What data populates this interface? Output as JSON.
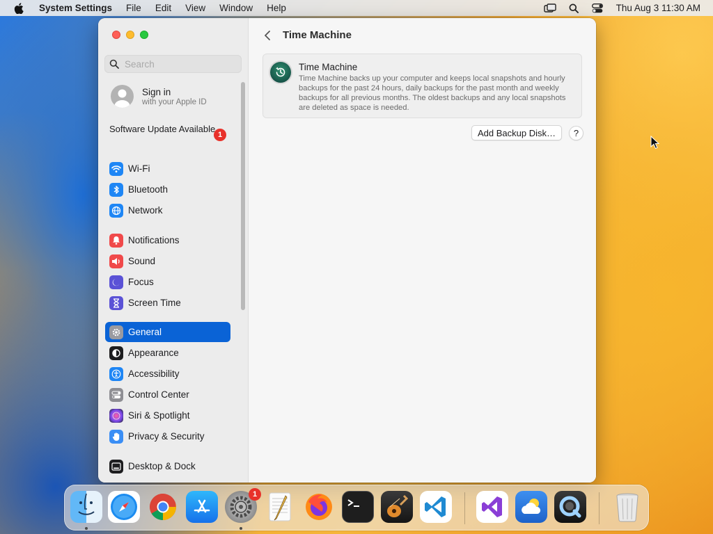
{
  "menubar": {
    "app_name": "System Settings",
    "menus": [
      "File",
      "Edit",
      "View",
      "Window",
      "Help"
    ],
    "clock": "Thu Aug 3  11:30 AM"
  },
  "sidebar": {
    "search_placeholder": "Search",
    "signin_title": "Sign in",
    "signin_subtitle": "with your Apple ID",
    "update_label": "Software Update Available",
    "update_badge": "1",
    "items": [
      {
        "label": "Wi-Fi",
        "color": "#1e86f5"
      },
      {
        "label": "Bluetooth",
        "color": "#1e86f5"
      },
      {
        "label": "Network",
        "color": "#1e86f5"
      },
      {
        "label": "Notifications",
        "color": "#f0494a"
      },
      {
        "label": "Sound",
        "color": "#f0494a"
      },
      {
        "label": "Focus",
        "color": "#5b52d6"
      },
      {
        "label": "Screen Time",
        "color": "#5b52d6"
      },
      {
        "label": "General",
        "color": "#8e8e93",
        "selected": true
      },
      {
        "label": "Appearance",
        "color": "#1d1d1f"
      },
      {
        "label": "Accessibility",
        "color": "#1e86f5"
      },
      {
        "label": "Control Center",
        "color": "#8e8e93"
      },
      {
        "label": "Siri & Spotlight",
        "color": "#c34bd8"
      },
      {
        "label": "Privacy & Security",
        "color": "#3a8ef5"
      },
      {
        "label": "Desktop & Dock",
        "color": "#1d1d1f"
      }
    ]
  },
  "content": {
    "title": "Time Machine",
    "card_title": "Time Machine",
    "card_description": "Time Machine backs up your computer and keeps local snapshots and hourly backups for the past 24 hours, daily backups for the past month and weekly backups for all previous months. The oldest backups and any local snapshots are deleted as space is needed.",
    "add_button": "Add Backup Disk…",
    "help_button": "?"
  },
  "dock": {
    "settings_badge": "1",
    "apps": [
      "Finder",
      "Safari",
      "Google Chrome",
      "App Store",
      "System Settings",
      "TextEdit",
      "Firefox",
      "Terminal",
      "GarageBand",
      "Visual Studio Code",
      "Visual Studio",
      "Weather",
      "QuickTime Player",
      "Trash"
    ]
  }
}
